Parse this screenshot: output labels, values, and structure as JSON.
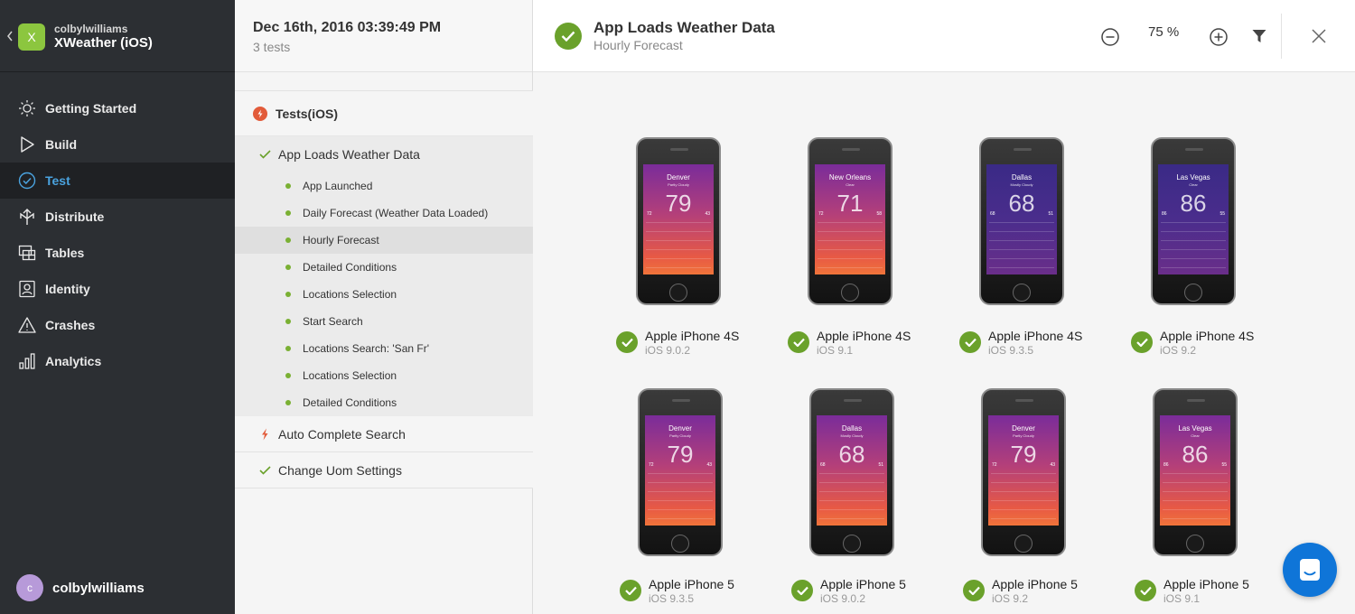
{
  "app": {
    "owner": "colbylwilliams",
    "name": "XWeather (iOS)",
    "icon_letter": "X",
    "icon_color": "#8cc63f"
  },
  "nav": [
    {
      "label": "Getting Started",
      "icon": "sun-icon",
      "active": false
    },
    {
      "label": "Build",
      "icon": "play-icon",
      "active": false
    },
    {
      "label": "Test",
      "icon": "check-circle-icon",
      "active": true
    },
    {
      "label": "Distribute",
      "icon": "distribute-icon",
      "active": false
    },
    {
      "label": "Tables",
      "icon": "table-icon",
      "active": false
    },
    {
      "label": "Identity",
      "icon": "identity-icon",
      "active": false
    },
    {
      "label": "Crashes",
      "icon": "warning-icon",
      "active": false
    },
    {
      "label": "Analytics",
      "icon": "bar-chart-icon",
      "active": false
    }
  ],
  "user": {
    "name": "colbylwilliams",
    "initial": "c"
  },
  "run": {
    "date": "Dec 16th, 2016 03:39:49 PM",
    "count": "3 tests"
  },
  "suite": {
    "title": "Tests(iOS)",
    "status": "failed"
  },
  "tests": [
    {
      "label": "App Loads Weather Data",
      "status": "passed",
      "steps": [
        "App Launched",
        "Daily Forecast (Weather Data Loaded)",
        "Hourly Forecast",
        "Detailed Conditions",
        "Locations Selection",
        "Start Search",
        "Locations Search: 'San Fr'",
        "Locations Selection",
        "Detailed Conditions"
      ],
      "selected_step": "Hourly Forecast"
    },
    {
      "label": "Auto Complete Search",
      "status": "failed"
    },
    {
      "label": "Change Uom Settings",
      "status": "passed"
    }
  ],
  "detail": {
    "title": "App Loads Weather Data",
    "subtitle": "Hourly Forecast",
    "zoom": "75 %"
  },
  "devices": [
    {
      "name": "Apple iPhone 4S",
      "os": "iOS 9.0.2",
      "city": "Denver",
      "cond": "Partly Cloudy",
      "temp": "79",
      "lo": "72",
      "hi": "43",
      "theme": "warm"
    },
    {
      "name": "Apple iPhone 4S",
      "os": "iOS 9.1",
      "city": "New Orleans",
      "cond": "Clear",
      "temp": "71",
      "lo": "72",
      "hi": "58",
      "theme": "warm"
    },
    {
      "name": "Apple iPhone 4S",
      "os": "iOS 9.3.5",
      "city": "Dallas",
      "cond": "Mostly Cloudy",
      "temp": "68",
      "lo": "68",
      "hi": "51",
      "theme": "cool"
    },
    {
      "name": "Apple iPhone 4S",
      "os": "iOS 9.2",
      "city": "Las Vegas",
      "cond": "Clear",
      "temp": "86",
      "lo": "86",
      "hi": "55",
      "theme": "cool"
    },
    {
      "name": "Apple iPhone 5",
      "os": "iOS 9.3.5",
      "city": "Denver",
      "cond": "Partly Cloudy",
      "temp": "79",
      "lo": "72",
      "hi": "43",
      "theme": "warm"
    },
    {
      "name": "Apple iPhone 5",
      "os": "iOS 9.0.2",
      "city": "Dallas",
      "cond": "Mostly Cloudy",
      "temp": "68",
      "lo": "68",
      "hi": "51",
      "theme": "warm"
    },
    {
      "name": "Apple iPhone 5",
      "os": "iOS 9.2",
      "city": "Denver",
      "cond": "Partly Cloudy",
      "temp": "79",
      "lo": "72",
      "hi": "43",
      "theme": "warm"
    },
    {
      "name": "Apple iPhone 5",
      "os": "iOS 9.1",
      "city": "Las Vegas",
      "cond": "Clear",
      "temp": "86",
      "lo": "86",
      "hi": "55",
      "theme": "warm"
    }
  ],
  "colors": {
    "accent": "#4aa3df",
    "pass": "#6aa12b",
    "fail": "#e25b3a",
    "sidebar": "#2c2f33",
    "chat": "#0f75d8"
  }
}
